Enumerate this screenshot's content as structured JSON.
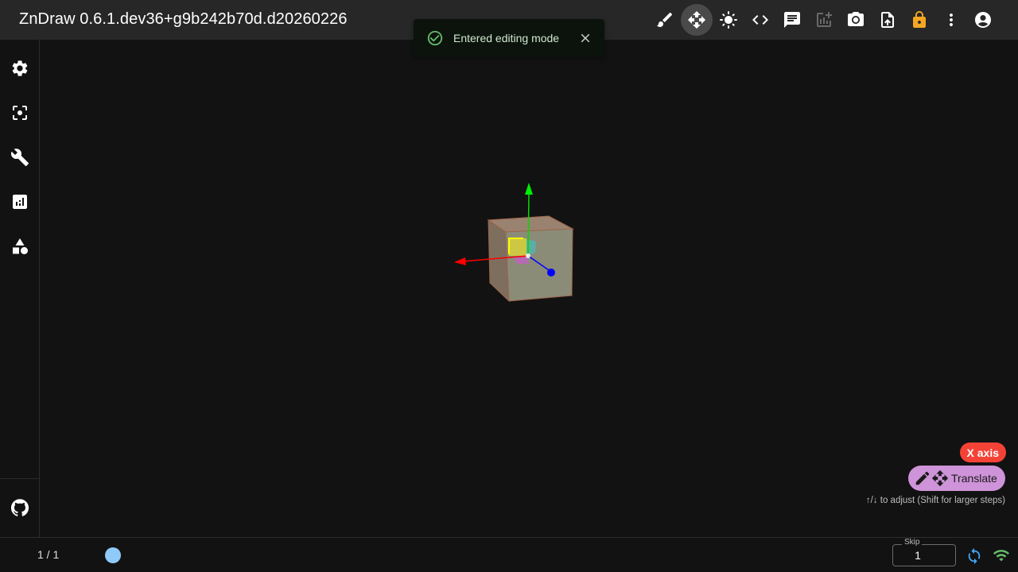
{
  "app": {
    "title": "ZnDraw 0.6.1.dev36+g9b242b70d.d20260226"
  },
  "toolbar": {
    "items": [
      {
        "name": "brush-icon",
        "state": "normal"
      },
      {
        "name": "move-icon",
        "state": "active"
      },
      {
        "name": "brightness-icon",
        "state": "normal"
      },
      {
        "name": "code-icon",
        "state": "normal"
      },
      {
        "name": "chat-icon",
        "state": "normal"
      },
      {
        "name": "add-chart-icon",
        "state": "disabled"
      },
      {
        "name": "camera-icon",
        "state": "normal"
      },
      {
        "name": "upload-file-icon",
        "state": "normal"
      },
      {
        "name": "lock-icon",
        "state": "warning",
        "color": "#f5a623"
      },
      {
        "name": "more-vert-icon",
        "state": "normal"
      },
      {
        "name": "account-icon",
        "state": "normal"
      }
    ]
  },
  "sidebar": {
    "items": [
      {
        "name": "settings-icon"
      },
      {
        "name": "center-focus-icon"
      },
      {
        "name": "wrench-icon"
      },
      {
        "name": "analytics-icon"
      },
      {
        "name": "shapes-icon"
      }
    ],
    "footer": {
      "name": "github-icon"
    }
  },
  "toast": {
    "message": "Entered editing mode",
    "icon": "check-circle-icon",
    "color": "#66bb6a"
  },
  "editor": {
    "axis_chip": "X axis",
    "axis_color": "#f44336",
    "mode_label": "Translate",
    "mode_color": "#ce93d8",
    "hint": "↑/↓ to adjust (Shift for larger steps)"
  },
  "bottombar": {
    "frame_counter": "1 / 1",
    "skip_label": "Skip",
    "skip_value": "1",
    "connection": "connected"
  },
  "colors": {
    "appbar": "#272727",
    "background": "#121212",
    "gizmo_x": "#ff0000",
    "gizmo_y": "#00ff00",
    "gizmo_z": "#0000ff",
    "cube": "#8a8a7a"
  }
}
